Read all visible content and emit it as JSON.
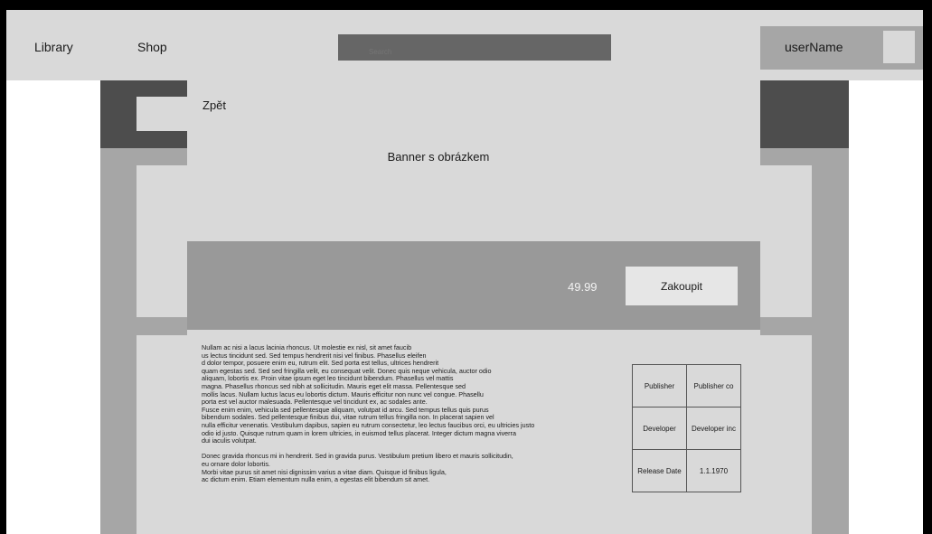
{
  "nav": {
    "library": "Library",
    "shop": "Shop",
    "search_placeholder": "Search"
  },
  "user": {
    "name": "userName"
  },
  "detail": {
    "back": "Zpět",
    "banner": "Banner s obrázkem",
    "price": "49.99",
    "buy": "Zakoupit",
    "description": [
      "Nullam ac nisi a lacus lacinia rhoncus. Ut molestie ex nisl, sit amet faucib\nus lectus tincidunt sed. Sed tempus hendrerit nisi vel finibus. Phasellus eleifen\nd dolor tempor, posuere enim eu, rutrum elit. Sed porta est tellus, ultrices hendrerit\nquam egestas sed. Sed sed fringilla velit, eu consequat velit. Donec quis neque vehicula, auctor odio\naliquam, lobortis ex. Proin vitae ipsum eget leo tincidunt bibendum. Phasellus vel mattis\nmagna. Phasellus rhoncus sed nibh at sollicitudin. Mauris eget elit massa. Pellentesque sed\nmollis lacus. Nullam luctus lacus eu lobortis dictum. Mauris efficitur non nunc vel congue. Phasellu\nporta est vel auctor malesuada. Pellentesque vel tincidunt ex, ac sodales ante.\nFusce enim enim, vehicula sed pellentesque aliquam, volutpat id arcu. Sed tempus tellus quis purus\nbibendum sodales. Sed pellentesque finibus dui, vitae rutrum tellus fringilla non. In placerat sapien vel\nnulla efficitur venenatis. Vestibulum dapibus, sapien eu rutrum consectetur, leo lectus faucibus orci, eu ultricies justo\n odio id justo. Quisque rutrum quam in lorem ultricies, in euismod tellus placerat. Integer dictum magna viverra\n dui iaculis volutpat.",
      "Donec gravida rhoncus mi in hendrerit. Sed in gravida purus. Vestibulum pretium libero et mauris sollicitudin,\neu ornare dolor lobortis.\nMorbi vitae purus sit amet nisi dignissim varius a vitae diam. Quisque id finibus ligula,\n ac dictum enim. Etiam elementum nulla enim, a egestas elit bibendum sit amet."
    ],
    "info": [
      {
        "label": "Publisher",
        "value": "Publisher co"
      },
      {
        "label": "Developer",
        "value": "Developer inc"
      },
      {
        "label": "Release Date",
        "value": "1.1.1970"
      }
    ]
  }
}
